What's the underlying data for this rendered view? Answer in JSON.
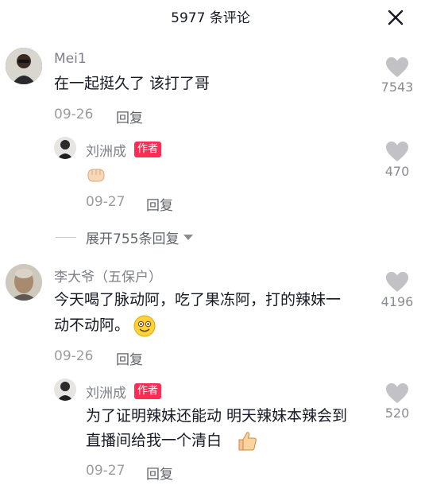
{
  "header": {
    "title": "5977 条评论"
  },
  "comments": [
    {
      "user": "Mei1",
      "text": "在一起挺久了 该打了哥",
      "date": "09-26",
      "reply": "回复",
      "likes": "7543",
      "avatar_icon": "user-avatar-dark"
    },
    {
      "user": "刘洲成",
      "badge": "作者",
      "text": "",
      "emoji_icon": "fist-emoji-icon",
      "date": "09-27",
      "reply": "回复",
      "likes": "470",
      "avatar_icon": "author-avatar"
    },
    {
      "user": "李大爷（五保户）",
      "text_line1": "今天喝了脉动阿，吃了果冻阿，打的辣妹一",
      "text_line2": "动不动阿。",
      "emoji_icon": "smiley-emoji-icon",
      "date": "09-26",
      "reply": "回复",
      "likes": "4196",
      "avatar_icon": "elderly-avatar"
    },
    {
      "user": "刘洲成",
      "badge": "作者",
      "text_line1": "为了证明辣妹还能动 明天辣妹本辣会到",
      "text_line2": "直播间给我一个清白",
      "emoji_icon": "thumbs-up-emoji-icon",
      "date": "09-27",
      "reply": "回复",
      "likes": "520",
      "avatar_icon": "author-avatar"
    }
  ],
  "expand": {
    "label": "展开755条回复"
  },
  "colors": {
    "badge": "#fe2c55",
    "like_icon": "#c2c2c6",
    "meta": "#9b9ba1"
  }
}
